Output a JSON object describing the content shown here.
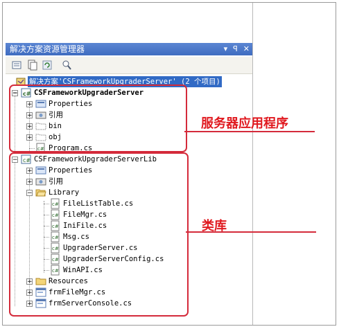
{
  "panel": {
    "title": "解决方案资源管理器",
    "title_buttons": [
      "▾",
      "ꟼ",
      "✕"
    ],
    "toolbar_icons": [
      "properties-icon",
      "show-all-files-icon",
      "refresh-icon",
      "view-class-diagram-icon"
    ]
  },
  "tree": {
    "solution": "解决方案'CSFrameworkUpgraderServer' (2 个项目)",
    "project1": {
      "name": "CSFrameworkUpgraderServer",
      "items": [
        "Properties",
        "引用",
        "bin",
        "obj",
        "Program.cs"
      ]
    },
    "project2": {
      "name": "CSFrameworkUpgraderServerLib",
      "items": [
        "Properties",
        "引用"
      ],
      "folder": "Library",
      "library_files": [
        "FileListTable.cs",
        "FileMgr.cs",
        "IniFile.cs",
        "Msg.cs",
        "UpgraderServer.cs",
        "UpgraderServerConfig.cs",
        "WinAPI.cs"
      ],
      "after": [
        "Resources",
        "frmFileMgr.cs",
        "frmServerConsole.cs"
      ]
    }
  },
  "annotations": {
    "server_label": "服务器应用程序",
    "lib_label": "类库",
    "color": "#e0191f"
  }
}
